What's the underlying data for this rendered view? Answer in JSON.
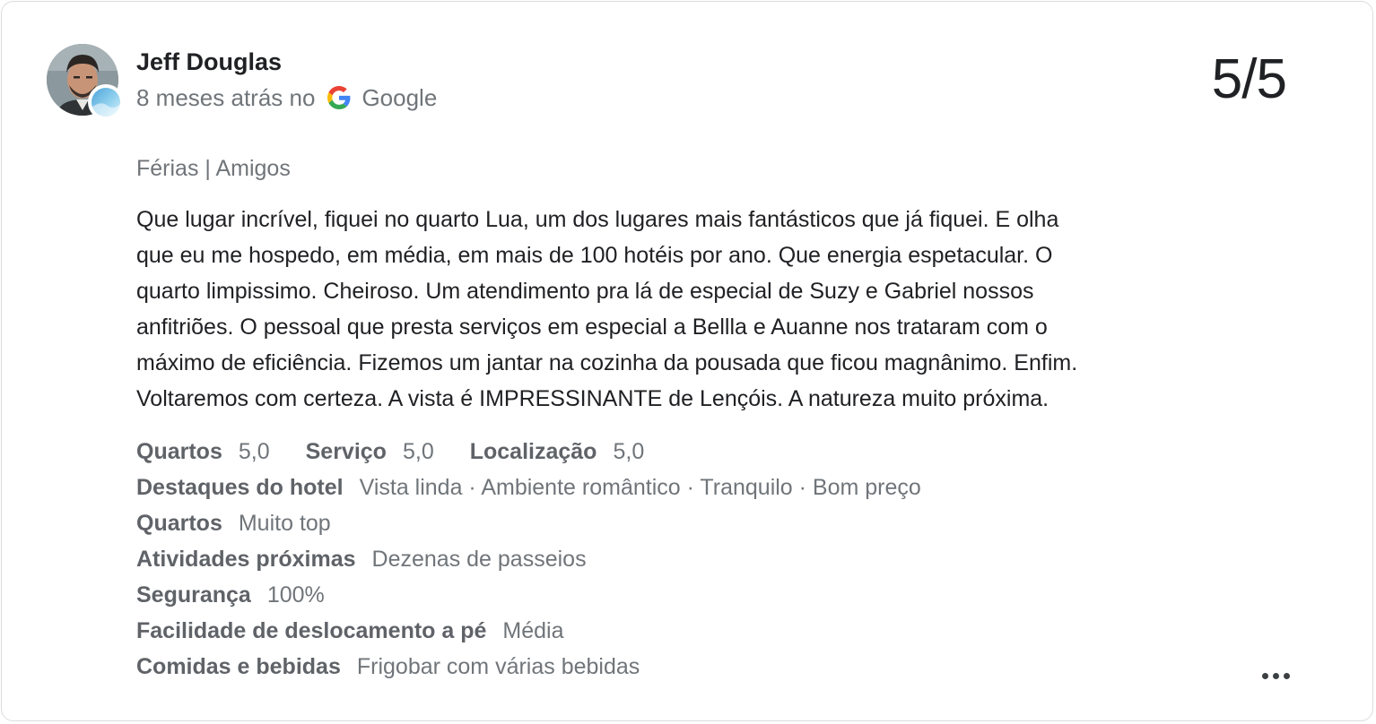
{
  "review": {
    "author": "Jeff Douglas",
    "time_ago": "8 meses atrás no",
    "source": "Google",
    "score": "5/5",
    "trip_type": "Férias | Amigos",
    "text_lines": [
      "Que lugar incrível, fiquei no quarto Lua, um dos lugares mais fantásticos que já fiquei. E olha",
      "que eu me hospedo, em média, em mais de 100 hotéis por ano. Que energia espetacular. O",
      "quarto limpissimo. Cheiroso. Um atendimento pra lá de especial de Suzy e Gabriel nossos",
      "anfitriões. O pessoal que presta serviços em especial a Bellla e Auanne nos trataram com o",
      "máximo de eficiência. Fizemos um jantar na cozinha da pousada que ficou magnânimo. Enfim.",
      "Voltaremos com certeza. A vista é IMPRESSINANTE de Lençóis. A natureza muito próxima."
    ],
    "ratings": [
      {
        "label": "Quartos",
        "value": "5,0"
      },
      {
        "label": "Serviço",
        "value": "5,0"
      },
      {
        "label": "Localização",
        "value": "5,0"
      }
    ],
    "attributes": [
      {
        "label": "Destaques do hotel",
        "value": "Vista linda · Ambiente romântico · Tranquilo · Bom preço"
      },
      {
        "label": "Quartos",
        "value": "Muito top"
      },
      {
        "label": "Atividades próximas",
        "value": "Dezenas de passeios"
      },
      {
        "label": "Segurança",
        "value": "100%"
      },
      {
        "label": "Facilidade de deslocamento a pé",
        "value": "Média"
      },
      {
        "label": "Comidas e bebidas",
        "value": "Frigobar com várias bebidas"
      }
    ]
  },
  "icons": {
    "source_logo": "google-g-icon",
    "avatar_badge": "local-guide-badge-icon",
    "more": "more-horizontal-icon"
  },
  "colors": {
    "google_blue": "#4285F4",
    "google_red": "#EA4335",
    "google_yellow": "#FBBC05",
    "google_green": "#34A853"
  }
}
